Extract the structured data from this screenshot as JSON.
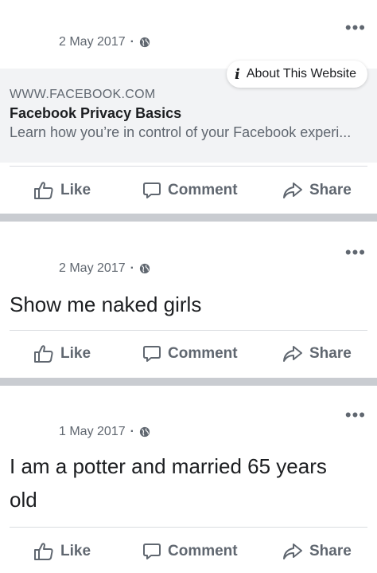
{
  "posts": [
    {
      "date": "2 May 2017",
      "sep": "·",
      "text": "",
      "link": {
        "domain": "WWW.FACEBOOK.COM",
        "title": "Facebook Privacy Basics",
        "description": "Learn how you’re in control of your Facebook experi..."
      },
      "about_label": "About This Website"
    },
    {
      "date": "2 May 2017",
      "sep": "·",
      "text": "Show me naked girls"
    },
    {
      "date": "1 May 2017",
      "sep": "·",
      "text_line1": "I am a potter and married 65 years",
      "text_line2": "old"
    }
  ],
  "actions": {
    "like": "Like",
    "comment": "Comment",
    "share": "Share"
  },
  "more_label": "•••",
  "icons": [
    "more-options-icon",
    "globe-icon",
    "info-icon",
    "like-icon",
    "comment-icon",
    "share-icon"
  ],
  "colors": {
    "text": "#1c1e21",
    "secondary": "#606770",
    "separator": "#c9ccd1",
    "link_bg": "#f2f3f5"
  }
}
